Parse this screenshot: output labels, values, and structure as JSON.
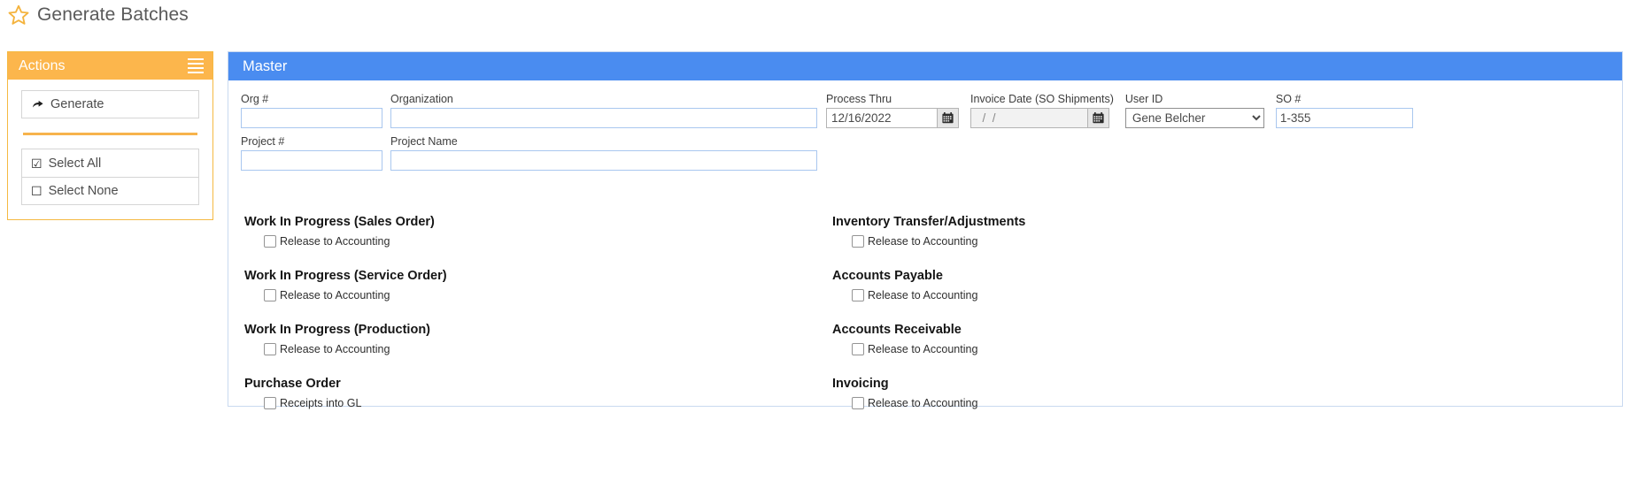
{
  "page": {
    "title": "Generate Batches",
    "star_icon": "star-outline-icon"
  },
  "actions": {
    "header_title": "Actions",
    "menu_icon": "hamburger-icon",
    "primary": [
      {
        "label": "Generate",
        "icon": "curved-arrow-right-icon"
      }
    ],
    "selection": [
      {
        "label": "Select All",
        "glyph": "☑"
      },
      {
        "label": "Select None",
        "glyph": "☐"
      }
    ]
  },
  "master": {
    "header_title": "Master",
    "fields": {
      "org_number": {
        "label": "Org #",
        "value": "",
        "placeholder": ""
      },
      "organization": {
        "label": "Organization",
        "value": "",
        "placeholder": ""
      },
      "project_number": {
        "label": "Project #",
        "value": "",
        "placeholder": ""
      },
      "project_name": {
        "label": "Project Name",
        "value": "",
        "placeholder": ""
      },
      "process_thru": {
        "label": "Process Thru",
        "value": "12/16/2022",
        "icon": "calendar-icon"
      },
      "invoice_date": {
        "label": "Invoice Date (SO Shipments)",
        "value": "  /  /",
        "icon": "calendar-icon"
      },
      "user_id": {
        "label": "User ID",
        "value": "Gene Belcher",
        "options": [
          "Gene Belcher"
        ]
      },
      "so_number": {
        "label": "SO #",
        "value": "1-355"
      }
    },
    "sections_left": [
      {
        "title": "Work In Progress (Sales Order)",
        "checkbox_label": "Release to Accounting",
        "checked": false
      },
      {
        "title": "Work In Progress (Service Order)",
        "checkbox_label": "Release to Accounting",
        "checked": false
      },
      {
        "title": "Work In Progress (Production)",
        "checkbox_label": "Release to Accounting",
        "checked": false
      },
      {
        "title": "Purchase Order",
        "checkbox_label": "Receipts into GL",
        "checked": false
      }
    ],
    "sections_right": [
      {
        "title": "Inventory Transfer/Adjustments",
        "checkbox_label": "Release to Accounting",
        "checked": false
      },
      {
        "title": "Accounts Payable",
        "checkbox_label": "Release to Accounting",
        "checked": false
      },
      {
        "title": "Accounts Receivable",
        "checkbox_label": "Release to Accounting",
        "checked": false
      },
      {
        "title": "Invoicing",
        "checkbox_label": "Release to Accounting",
        "checked": false
      }
    ]
  },
  "colors": {
    "accent_orange": "#fcb64c",
    "accent_blue": "#4a8cf0",
    "input_border_blue": "#a9c7ef"
  }
}
